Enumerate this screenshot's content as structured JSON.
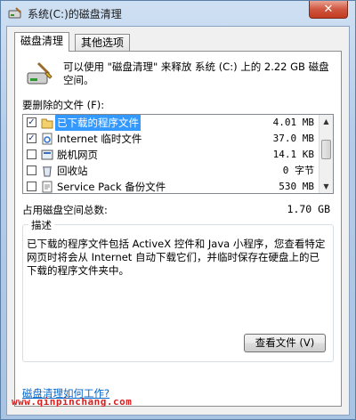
{
  "window": {
    "title": "系统(C:)的磁盘清理",
    "close_label": "✕"
  },
  "tabs": [
    {
      "label": "磁盘清理"
    },
    {
      "label": "其他选项"
    }
  ],
  "intro_text": "可以使用 \"磁盘清理\" 来释放 系统 (C:) 上的 2.22 GB 磁盘空间。",
  "files_label": "要删除的文件 (F):",
  "files": [
    {
      "name": "已下载的程序文件",
      "size": "4.01 MB",
      "checked": true,
      "icon": "folder-icon"
    },
    {
      "name": "Internet 临时文件",
      "size": "37.0 MB",
      "checked": true,
      "icon": "ie-file-icon"
    },
    {
      "name": "脱机网页",
      "size": "14.1 KB",
      "checked": false,
      "icon": "offline-page-icon"
    },
    {
      "name": "回收站",
      "size": "0 字节",
      "checked": false,
      "icon": "recycle-bin-icon"
    },
    {
      "name": "Service Pack 备份文件",
      "size": "530 MB",
      "checked": false,
      "icon": "backup-file-icon"
    }
  ],
  "total": {
    "label": "占用磁盘空间总数:",
    "value": "1.70 GB"
  },
  "description": {
    "legend": "描述",
    "text": "已下载的程序文件包括 ActiveX 控件和 Java 小程序，您查看特定网页时将会从 Internet 自动下载它们，并临时保存在硬盘上的已下载的程序文件夹中。"
  },
  "view_files_label": "查看文件 (V)",
  "help_link": "磁盘清理如何工作?",
  "watermark": "www.qinpinchang.com",
  "colors": {
    "selection": "#3399ff",
    "link": "#0066cc",
    "watermark": "#d81e1e"
  }
}
